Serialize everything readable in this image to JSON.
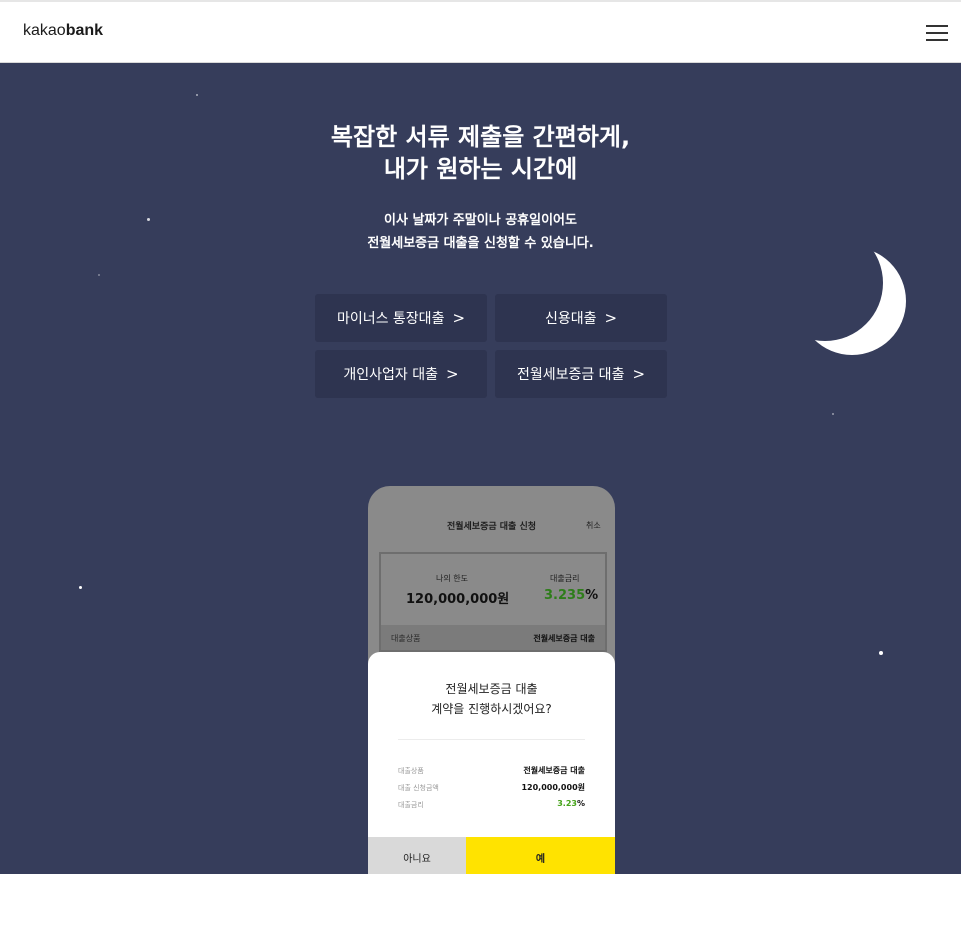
{
  "header": {
    "logo_light": "kakao",
    "logo_bold": "bank",
    "menu_icon": "hamburger-menu-icon"
  },
  "hero": {
    "title_line1": "복잡한 서류 제출을 간편하게,",
    "title_line2": "내가 원하는 시간에",
    "subtitle_line1": "이사 날짜가 주말이나 공휴일이어도",
    "subtitle_line2": "전월세보증금 대출을 신청할 수 있습니다.",
    "buttons": [
      {
        "label": "마이너스 통장대출"
      },
      {
        "label": "신용대출"
      },
      {
        "label": "개인사업자 대출"
      },
      {
        "label": "전월세보증금 대출"
      }
    ],
    "chevron": ">"
  },
  "phone": {
    "screen_title": "전월세보증금 대출 신청",
    "cancel": "취소",
    "limit_label": "나의 한도",
    "limit_value": "120,000,000원",
    "rate_label": "대출금리",
    "rate_number": "3.235",
    "rate_unit": "%",
    "product_label": "대출상품",
    "product_value": "전월세보증금 대출",
    "dialog": {
      "title_line1": "전월세보증금 대출",
      "title_line2": "계약을 진행하시겠어요?",
      "rows": [
        {
          "label": "대출상품",
          "value": "전월세보증금 대출"
        },
        {
          "label": "대출 신청금액",
          "value": "120,000,000원"
        },
        {
          "label": "대출금리",
          "value": "3.23",
          "unit": "%"
        }
      ],
      "no_label": "아니요",
      "yes_label": "예"
    }
  },
  "colors": {
    "hero_bg": "#363d5b",
    "button_bg": "#2e3450",
    "accent_yellow": "#ffe300",
    "rate_green": "#45a319"
  }
}
